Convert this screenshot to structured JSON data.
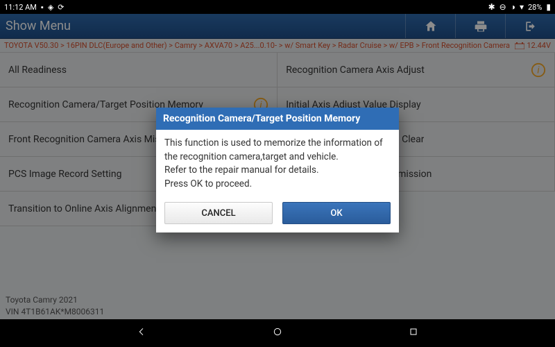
{
  "status": {
    "time": "11:12 AM",
    "battery": "28%"
  },
  "header": {
    "title": "Show Menu"
  },
  "breadcrumb": "TOYOTA V50.30 > 16PIN DLC(Europe and Other) > Camry > AXVA70 > A25...0.10- > w/ Smart Key > Radar Cruise > w/ EPB > Front Recognition Camera",
  "voltage": "12.44V",
  "menu": {
    "items": [
      {
        "label": "All Readiness",
        "info": false
      },
      {
        "label": "Recognition Camera Axis Adjust",
        "info": true
      },
      {
        "label": "Recognition Camera/Target Position Memory",
        "info": true
      },
      {
        "label": "Initial Axis Adjust Value Display",
        "info": false
      },
      {
        "label": "Front Recognition Camera Axis Misalignment Record Setting",
        "info": false
      },
      {
        "label": "PCS Image Record Setting Clear",
        "info": false
      },
      {
        "label": "PCS Image Record Setting",
        "info": false
      },
      {
        "label": "Online Axis Alignment Permission",
        "info": false
      },
      {
        "label": "Transition to Online Axis Alignment",
        "info": false
      }
    ]
  },
  "vehicle": {
    "model": "Toyota Camry 2021",
    "vin": "VIN 4T1B61AK*M8006311"
  },
  "dialog": {
    "title": "Recognition Camera/Target Position Memory",
    "body_line1": "This function is used to memorize the information of the recognition camera,target and vehicle.",
    "body_line2": "Refer to the repair manual for details.",
    "body_line3": "Press OK to proceed.",
    "cancel": "CANCEL",
    "ok": "OK"
  }
}
